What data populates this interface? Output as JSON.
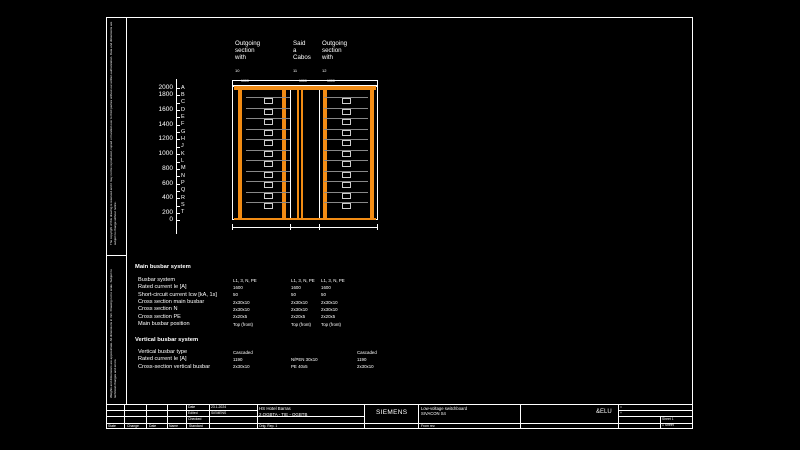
{
  "margin_note_top": "The copyright of this drawing is reserved and it may not be reproduced, copied or handed over to third parties without our written authorization. Data and dimensions are subject to change without notice.",
  "margin_note_bottom": "Weights and dimensions are approximate. All dimensions in mm. Drawing not to scale. Subject to technical changes and errors.",
  "sections": [
    {
      "title": "Outgoing\nsection\nwith",
      "number": "10",
      "plate": "1000"
    },
    {
      "title": "Said\na\nCabos",
      "number": "11",
      "plate": "1000"
    },
    {
      "title": "Outgoing\nsection\nwith",
      "number": "12",
      "plate": "1000"
    }
  ],
  "height_scale": [
    {
      "value": "2000",
      "letter": "A"
    },
    {
      "value": "1800",
      "letter": "B"
    },
    {
      "value": "",
      "letter": "C"
    },
    {
      "value": "1600",
      "letter": "D"
    },
    {
      "value": "",
      "letter": "E"
    },
    {
      "value": "1400",
      "letter": "F"
    },
    {
      "value": "",
      "letter": "G"
    },
    {
      "value": "1200",
      "letter": "H"
    },
    {
      "value": "",
      "letter": "J"
    },
    {
      "value": "1000",
      "letter": "K"
    },
    {
      "value": "",
      "letter": "L"
    },
    {
      "value": "800",
      "letter": "M"
    },
    {
      "value": "",
      "letter": "N"
    },
    {
      "value": "600",
      "letter": "P"
    },
    {
      "value": "",
      "letter": "Q"
    },
    {
      "value": "400",
      "letter": "R"
    },
    {
      "value": "",
      "letter": "S"
    },
    {
      "value": "200",
      "letter": "T"
    },
    {
      "value": "0",
      "letter": ""
    }
  ],
  "main_busbar": {
    "heading": "Main busbar system",
    "rows": [
      {
        "label": "Busbar system",
        "values": [
          "L1, 3, N, PE",
          "L1, 3, N, PE",
          "L1, 3, N, PE"
        ]
      },
      {
        "label": "Rated current Ie [A]",
        "values": [
          "1600",
          "1600",
          "1600"
        ]
      },
      {
        "label": "Short-circuit current Icw [kA, 1s]",
        "values": [
          "50",
          "50",
          "50"
        ]
      },
      {
        "label": "Cross section main busbar",
        "values": [
          "2x30x10",
          "2x30x10",
          "2x30x10"
        ]
      },
      {
        "label": "Cross section N",
        "values": [
          "2x30x10",
          "2x30x10",
          "2x30x10"
        ]
      },
      {
        "label": "Cross section PE",
        "values": [
          "2x20x5",
          "2x20x5",
          "2x20x5"
        ]
      },
      {
        "label": "Main busbar position",
        "values": [
          "Top (front)",
          "Top (front)",
          "Top (front)"
        ]
      }
    ]
  },
  "vertical_busbar": {
    "heading": "Vertical busbar system",
    "rows": [
      {
        "label": "Vertical busbar type",
        "values": [
          "Cascaded",
          "",
          "Cascaded"
        ]
      },
      {
        "label": "Rated current Ie [A]",
        "values": [
          "1190",
          "N/PEN 30x10",
          "1190"
        ]
      },
      {
        "label": "Cross-section vertical busbar",
        "values": [
          "2x30x10",
          "PE 40x5",
          "2x30x10"
        ]
      }
    ]
  },
  "title_block": {
    "col_headers": [
      "State",
      "Change",
      "Date",
      "Name",
      "Standard"
    ],
    "date_label": "Date",
    "date_value": "23.1.2024",
    "edited_label": "Edited",
    "edited_value": "SIEMENS",
    "checked_label": "Checked",
    "project_name": "HS Hotel Barras",
    "project_code": "2.QGBTA - TIE - QGBTB",
    "drawing_ref": "Orig. Rep. 1",
    "company": "SIEMENS",
    "product_line1": "Low-voltage switchboard",
    "product_line2": "SIVACON S4",
    "from_label": "From rev.",
    "doc_code": "&ELU",
    "sheet_top1": "=",
    "sheet_top2": "+",
    "sheet_label": "Sheet 1",
    "sheets_label": "1 Sheet"
  },
  "colors": {
    "busbar": "#f28c14",
    "line": "#ffffff",
    "background": "#000000"
  }
}
